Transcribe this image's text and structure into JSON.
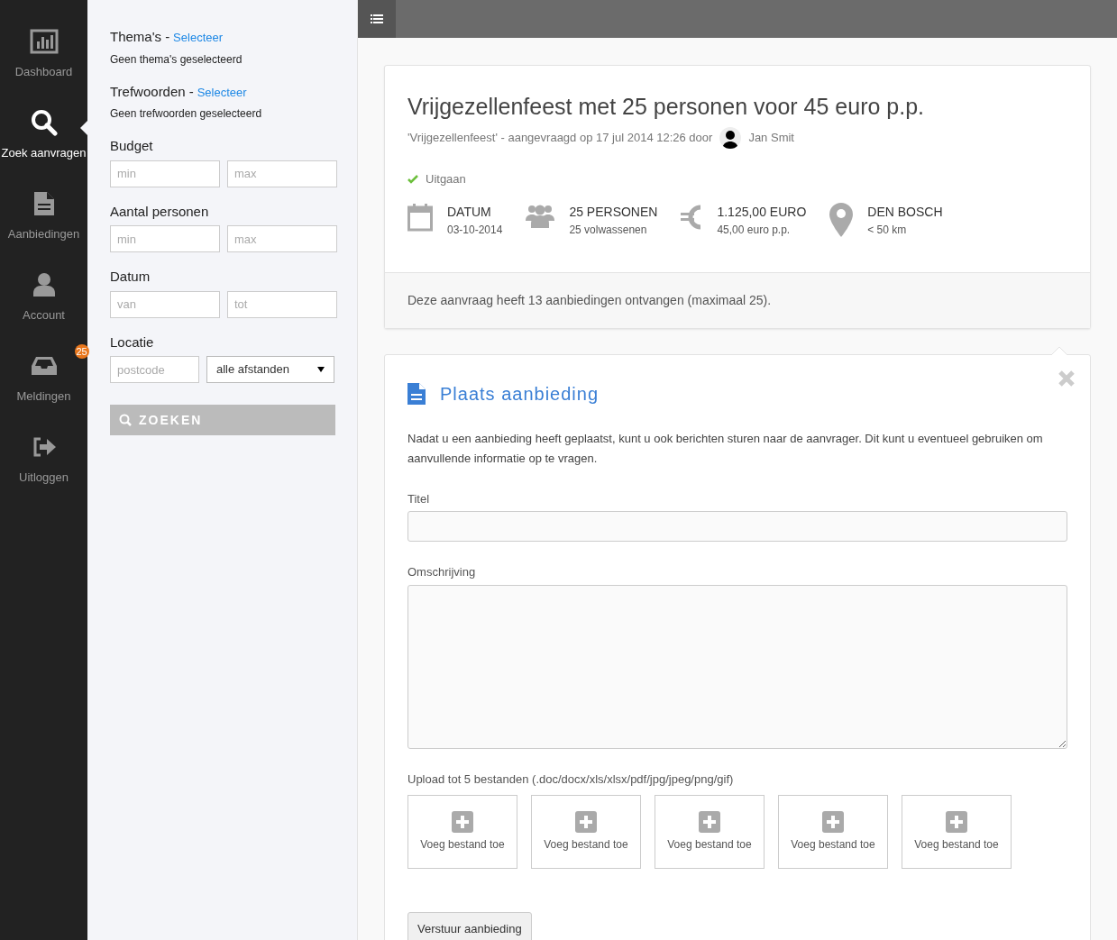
{
  "nav": [
    {
      "label": "Dashboard",
      "selected": false
    },
    {
      "label": "Zoek aanvragen",
      "selected": true
    },
    {
      "label": "Aanbiedingen",
      "selected": false
    },
    {
      "label": "Account",
      "selected": false
    },
    {
      "label": "Meldingen",
      "selected": false,
      "badge": "25"
    },
    {
      "label": "Uitloggen",
      "selected": false
    }
  ],
  "filters": {
    "selectors": [
      {
        "label": "Thema's -",
        "link": "Selecteer",
        "note": "Geen thema's geselecteerd"
      },
      {
        "label": "Trefwoorden -",
        "link": "Selecteer",
        "note": "Geen trefwoorden geselecteerd"
      }
    ],
    "ranges": [
      {
        "label": "Budget",
        "fields": [
          {
            "placeholder": "min"
          },
          {
            "placeholder": "max"
          }
        ]
      },
      {
        "label": "Aantal personen",
        "fields": [
          {
            "placeholder": "min"
          },
          {
            "placeholder": "max"
          }
        ]
      },
      {
        "label": "Datum",
        "fields": [
          {
            "placeholder": "van"
          },
          {
            "placeholder": "tot"
          }
        ]
      }
    ],
    "location": {
      "label": "Locatie",
      "placeholder": "postcode",
      "distance": "alle afstanden"
    },
    "search_button": "ZOEKEN"
  },
  "request": {
    "title": "Vrijgezellenfeest met 25 personen voor 45 euro p.p.",
    "meta": "'Vrijgezellenfeest' - aangevraagd op 17 jul 2014 12:26 door",
    "requester": "Jan Smit",
    "category": "Uitgaan",
    "facts": [
      {
        "title": "DATUM",
        "sub": "03-10-2014"
      },
      {
        "title": "25 PERSONEN",
        "sub": "25 volwassenen"
      },
      {
        "title": "1.125,00 EURO",
        "sub": "45,00 euro p.p."
      },
      {
        "title": "DEN BOSCH",
        "sub": "< 50 km"
      }
    ],
    "offers_note": "Deze aanvraag heeft 13 aanbiedingen ontvangen (maximaal 25)."
  },
  "offer_form": {
    "title": "Plaats aanbieding",
    "intro": "Nadat u een aanbieding heeft geplaatst, kunt u ook berichten sturen naar de aanvrager. Dit kunt u eventueel gebruiken om aanvullende informatie op te vragen.",
    "fields": [
      {
        "label": "Titel",
        "kind": "input"
      },
      {
        "label": "Omschrijving",
        "kind": "textarea"
      }
    ],
    "upload_label": "Upload tot 5 bestanden (.doc/docx/xls/xlsx/pdf/jpg/jpeg/png/gif)",
    "uploads": [
      "Voeg bestand toe",
      "Voeg bestand toe",
      "Voeg bestand toe",
      "Voeg bestand toe",
      "Voeg bestand toe"
    ],
    "submit": "Verstuur aanbieding"
  }
}
